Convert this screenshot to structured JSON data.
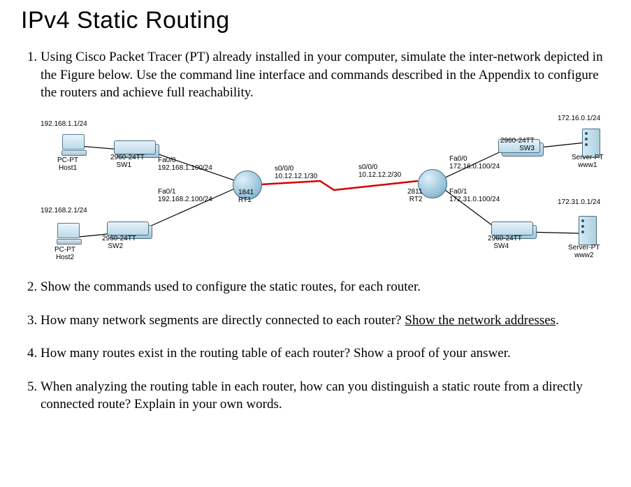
{
  "title": "IPv4 Static Routing",
  "questions": {
    "q1": "Using Cisco Packet Tracer (PT) already installed in your computer, simulate the inter-network depicted in the Figure below. Use the command line interface and commands described in the Appendix to configure the routers and achieve full reachability.",
    "q2": "Show the commands used to configure the static routes, for each router.",
    "q3a": "How many network segments are directly connected to each router? ",
    "q3b": "Show the network addresses",
    "q3c": ".",
    "q4": "How many routes exist in the routing table of each router? Show a proof of your answer.",
    "q5": "When analyzing the routing table in each router, how can you distinguish a static route from a directly connected route? Explain in your own words."
  },
  "diagram": {
    "host1_ip": "192.168.1.1/24",
    "host1_type": "PC-PT",
    "host1_name": "Host1",
    "sw1_model": "2960-24TT",
    "sw1_name": "SW1",
    "rt1_fa00": "Fa0/0",
    "rt1_fa00_ip": "192.168.1.100/24",
    "rt1_fa01": "Fa0/1",
    "rt1_fa01_ip": "192.168.2.100/24",
    "rt1_model": "1841",
    "rt1_name": "RT1",
    "rt1_s000": "s0/0/0",
    "rt1_s000_ip": "10.12.12.1/30",
    "rt2_s000": "s0/0/0",
    "rt2_s000_ip": "10.12.12.2/30",
    "rt2_fa00": "Fa0/0",
    "rt2_fa00_ip": "172.16.0.100/24",
    "rt2_fa01": "Fa0/1",
    "rt2_fa01_ip": "172.31.0.100/24",
    "rt2_model": "2811",
    "rt2_name": "RT2",
    "host2_ip": "192.168.2.1/24",
    "host2_type": "PC-PT",
    "host2_name": "Host2",
    "sw2_model": "2960-24TT",
    "sw2_name": "SW2",
    "www1_ip": "172.16.0.1/24",
    "www1_type": "Server-PT",
    "www1_name": "www1",
    "sw3_model": "2960-24TT",
    "sw3_name": "SW3",
    "www2_ip": "172.31.0.1/24",
    "www2_type": "Server-PT",
    "www2_name": "www2",
    "sw4_model": "2960-24TT",
    "sw4_name": "SW4"
  }
}
